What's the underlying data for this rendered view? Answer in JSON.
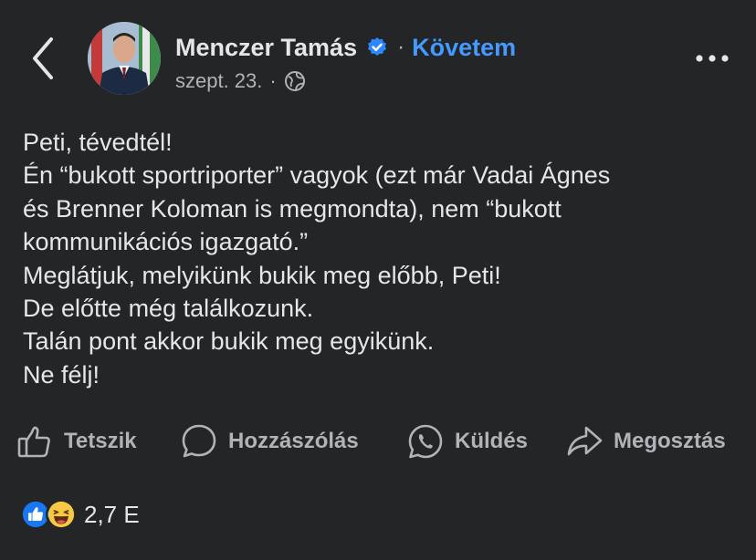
{
  "post": {
    "author": "Menczer Tamás",
    "follow_label": "Követem",
    "date": "szept. 23.",
    "separator": "·",
    "body_lines": [
      "Peti, tévedtél!",
      "Én “bukott sportriporter” vagyok (ezt már Vadai Ágnes",
      "és Brenner Koloman is megmondta), nem “bukott",
      "kommunikációs igazgató.”",
      "Meglátjuk, melyikünk bukik meg előbb, Peti!",
      "De előtte még találkozunk.",
      "Talán pont akkor bukik meg egyikünk.",
      "Ne félj!"
    ]
  },
  "actions": {
    "like": "Tetszik",
    "comment": "Hozzászólás",
    "send": "Küldés",
    "share": "Megosztás"
  },
  "reactions": {
    "count": "2,7 E",
    "types": [
      "like-icon",
      "haha-icon"
    ]
  },
  "colors": {
    "background": "#242526",
    "text": "#e4e6eb",
    "secondary": "#b0b3b8",
    "accent": "#4599ff"
  }
}
